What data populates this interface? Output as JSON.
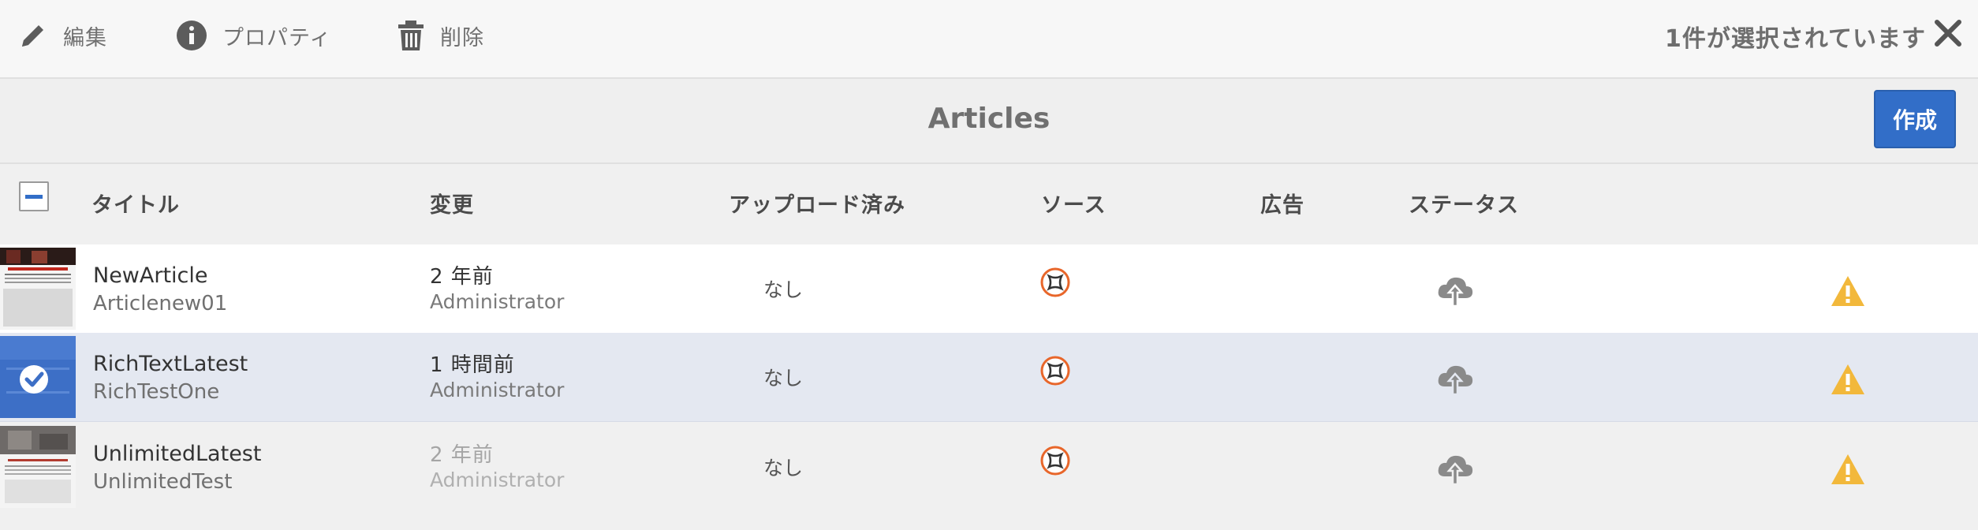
{
  "toolbar": {
    "edit_label": "編集",
    "properties_label": "プロパティ",
    "delete_label": "削除",
    "selection_text": "1件が選択されています"
  },
  "page": {
    "title": "Articles",
    "create_label": "作成"
  },
  "columns": {
    "title": "タイトル",
    "modified": "変更",
    "uploaded": "アップロード済み",
    "source": "ソース",
    "ads": "広告",
    "status": "ステータス"
  },
  "rows": [
    {
      "title": "NewArticle",
      "name": "Articlenew01",
      "modified": "2 年前",
      "modified_by": "Administrator",
      "uploaded": "なし",
      "selected": false
    },
    {
      "title": "RichTextLatest",
      "name": "RichTestOne",
      "modified": "1 時間前",
      "modified_by": "Administrator",
      "uploaded": "なし",
      "selected": true
    },
    {
      "title": "UnlimitedLatest",
      "name": "UnlimitedTest",
      "modified": "2 年前",
      "modified_by": "Administrator",
      "uploaded": "なし",
      "selected": false
    }
  ],
  "icons": {
    "edit": "pencil-icon",
    "properties": "info-icon",
    "delete": "trash-icon",
    "close": "close-icon",
    "source": "source-app-icon",
    "status": "cloud-upload-icon",
    "warning": "warning-icon"
  },
  "colors": {
    "accent": "#326ec8",
    "selected_row": "#e4e8f1",
    "source_icon": "#e8662a",
    "warning": "#f2b83b"
  }
}
